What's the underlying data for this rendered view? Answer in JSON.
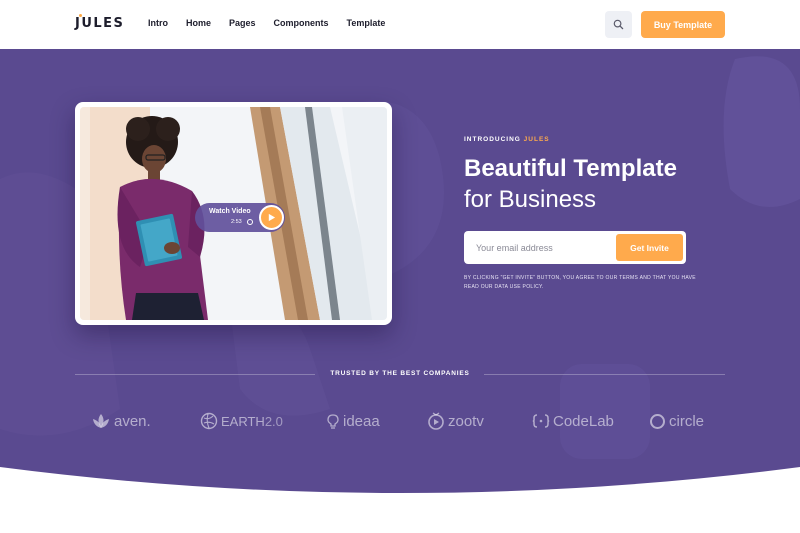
{
  "header": {
    "brand": "JULES",
    "nav": [
      "Intro",
      "Home",
      "Pages",
      "Components",
      "Template"
    ],
    "search_icon": "search-icon",
    "buy_label": "Buy Template"
  },
  "hero": {
    "video": {
      "label": "Watch Video",
      "duration": "2:53",
      "play_icon": "play-icon",
      "clock_icon": "clock-icon"
    },
    "intro_prefix": "INTRODUCING",
    "intro_brand": "JULES",
    "headline_line1": "Beautiful Template",
    "headline_line2": "for Business",
    "email_placeholder": "Your email address",
    "invite_label": "Get Invite",
    "disclaimer": "BY CLICKING \"GET INVITE\" BUTTON, YOU AGREE TO OUR TERMS AND THAT YOU HAVE READ OUR DATA USE POLICY."
  },
  "trusted": {
    "title": "TRUSTED BY THE BEST COMPANIES",
    "logos": [
      {
        "name": "aven.",
        "icon": "lotus-icon"
      },
      {
        "name": "EARTH",
        "suffix": "2.0",
        "icon": "globe-icon"
      },
      {
        "name": "ideaa",
        "icon": "bulb-icon"
      },
      {
        "name": "zootv",
        "icon": "tv-play-icon"
      },
      {
        "name": "CodeLab",
        "icon": "braces-icon"
      },
      {
        "name": "circle",
        "icon": "ring-icon"
      }
    ]
  },
  "colors": {
    "primary": "#5a4a90",
    "accent": "#ffaa4c",
    "text_dark": "#1d1d2c"
  }
}
